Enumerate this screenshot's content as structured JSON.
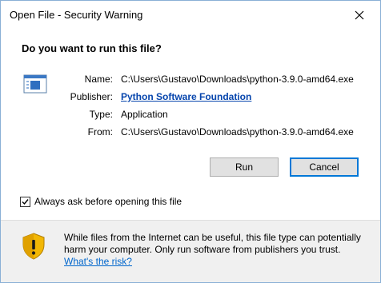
{
  "window": {
    "title": "Open File - Security Warning"
  },
  "dialog": {
    "question": "Do you want to run this file?",
    "fields": {
      "name_label": "Name:",
      "name_value": "C:\\Users\\Gustavo\\Downloads\\python-3.9.0-amd64.exe",
      "publisher_label": "Publisher:",
      "publisher_value": "Python Software Foundation",
      "type_label": "Type:",
      "type_value": "Application",
      "from_label": "From:",
      "from_value": "C:\\Users\\Gustavo\\Downloads\\python-3.9.0-amd64.exe"
    },
    "buttons": {
      "run": "Run",
      "cancel": "Cancel"
    },
    "checkbox": {
      "label": "Always ask before opening this file",
      "checked": true
    }
  },
  "footer": {
    "warning_text": "While files from the Internet can be useful, this file type can potentially harm your computer. Only run software from publishers you trust.",
    "risk_link": "What's the risk?"
  },
  "colors": {
    "default_button_border": "#0078d7",
    "link": "#0645ad",
    "shield_yellow": "#f2b705"
  }
}
